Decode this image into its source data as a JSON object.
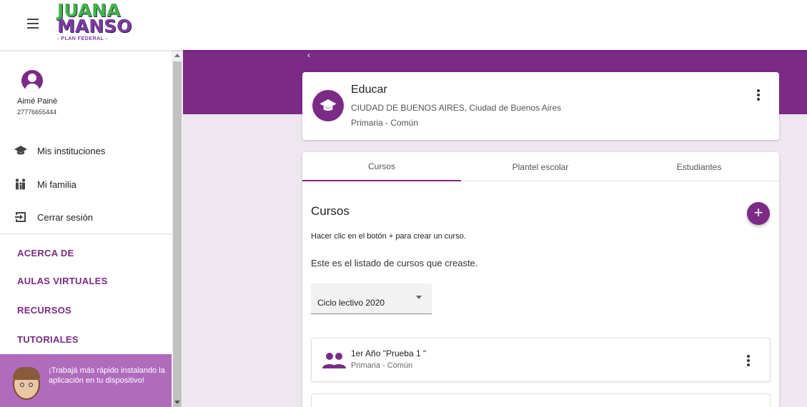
{
  "header": {
    "logo_line1": "JUANA",
    "logo_line2": "MANSO",
    "logo_line3": "- PLAN FEDERAL -"
  },
  "user": {
    "name": "Aimé Painé",
    "id": "27776655444"
  },
  "sidebar": {
    "items": [
      {
        "label": "Mis instituciones",
        "icon": "graduation-cap-icon"
      },
      {
        "label": "Mi familia",
        "icon": "family-icon"
      },
      {
        "label": "Cerrar sesión",
        "icon": "logout-icon"
      }
    ],
    "links": [
      "ACERCA DE",
      "AULAS VIRTUALES",
      "RECURSOS",
      "TUTORIALES"
    ],
    "install_banner": "¡Trabajá más rápido instalando la aplicación en tu dispositivo!"
  },
  "institution": {
    "name": "Educar",
    "location": "CIUDAD DE BUENOS AIRES, Ciudad de Buenos Aires",
    "level": "Primaria - Común"
  },
  "tabs": [
    "Cursos",
    "Plantel escolar",
    "Estudiantes"
  ],
  "courses": {
    "title": "Cursos",
    "fab_label": "+",
    "hint": "Hacer clic en el botón + para crear un curso.",
    "intro": "Este es el listado de cursos que creaste.",
    "cycle_select": "Ciclo lectivo 2020",
    "items": [
      {
        "name": "1er Año \"Prueba 1 \"",
        "level": "Primaria - Común"
      }
    ]
  },
  "colors": {
    "primary": "#7b2a86",
    "banner": "#b06bbd",
    "background": "#eee7f0"
  }
}
